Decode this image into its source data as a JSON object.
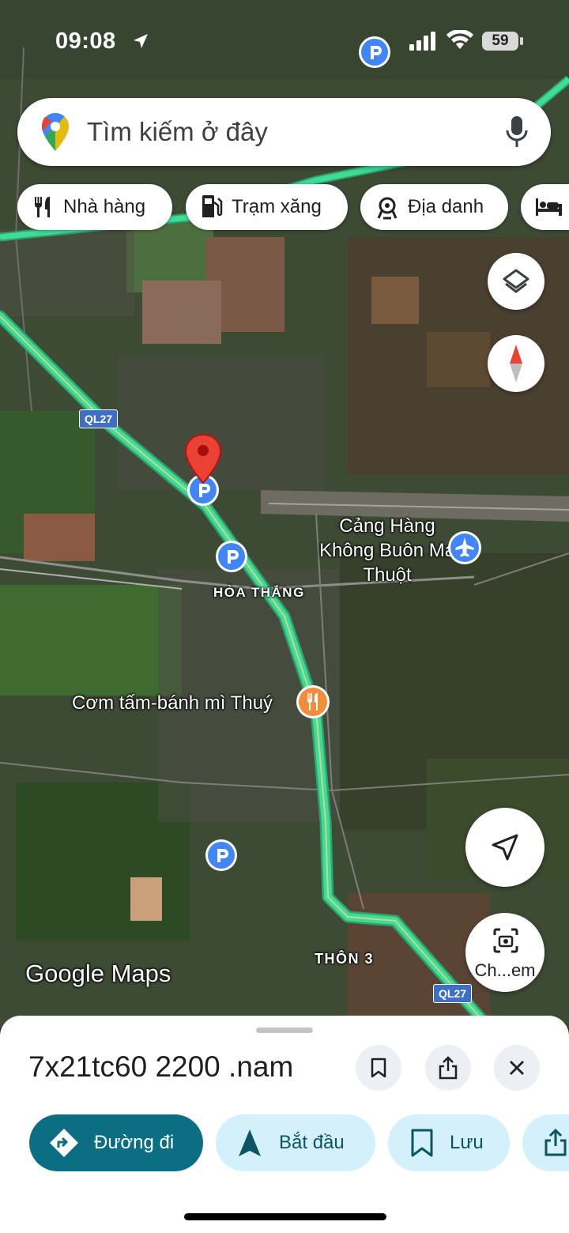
{
  "status_bar": {
    "time": "09:08",
    "battery": "59"
  },
  "search": {
    "placeholder": "Tìm kiếm ở đây"
  },
  "chips": [
    {
      "label": "Nhà hàng",
      "icon": "restaurant-icon"
    },
    {
      "label": "Trạm xăng",
      "icon": "gas-station-icon"
    },
    {
      "label": "Địa danh",
      "icon": "landmark-icon"
    },
    {
      "label": "",
      "icon": "hotel-icon"
    }
  ],
  "map": {
    "labels": {
      "airport": "Cảng Hàng Không Buôn Ma Thuột",
      "restaurant": "Cơm tấm-bánh mì Thuý",
      "area_hoa_thang": "HÒA THẮNG",
      "area_thon3": "THÔN 3",
      "road_top": "QL27",
      "road_bottom": "QL27"
    },
    "watermark": "Google Maps",
    "route_color": "#3ddc97",
    "pin_color": "#ea4335"
  },
  "controls": {
    "street_view_label": "Ch...em"
  },
  "sheet": {
    "title": "7x21tc60 2200 .nam",
    "actions": {
      "directions": "Đường đi",
      "start": "Bắt đầu",
      "save": "Lưu"
    }
  }
}
